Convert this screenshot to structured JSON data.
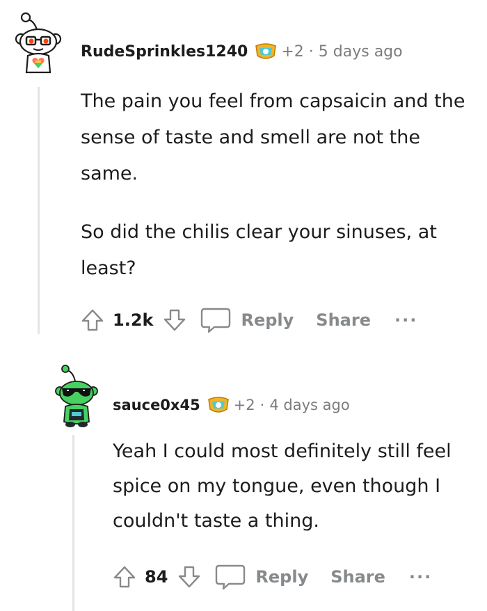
{
  "comments": [
    {
      "username": "RudeSprinkles1240",
      "points": "+2",
      "separator": "·",
      "time": "5 days ago",
      "paragraphs": [
        "The pain you feel from capsaicin and the sense of taste and smell are not the same.",
        "So did the chilis clear your sinuses, at least?"
      ],
      "score": "1.2k",
      "reply_label": "Reply",
      "share_label": "Share",
      "more_label": "···"
    },
    {
      "username": "sauce0x45",
      "points": "+2",
      "separator": "·",
      "time": "4 days ago",
      "paragraphs": [
        "Yeah I could most definitely still feel spice on my tongue, even though I couldn't taste a thing."
      ],
      "score": "84",
      "reply_label": "Reply",
      "share_label": "Share",
      "more_label": "···"
    }
  ],
  "colors": {
    "avatar_green": "#46d160",
    "avatar_orange": "#ff4500",
    "thread_line": "#e4e4e4",
    "action_gray": "#878a8c"
  },
  "icons": [
    "snoo-avatar-icon",
    "award-badge-icon",
    "upvote-icon",
    "downvote-icon",
    "comment-bubble-icon",
    "more-options-icon"
  ]
}
